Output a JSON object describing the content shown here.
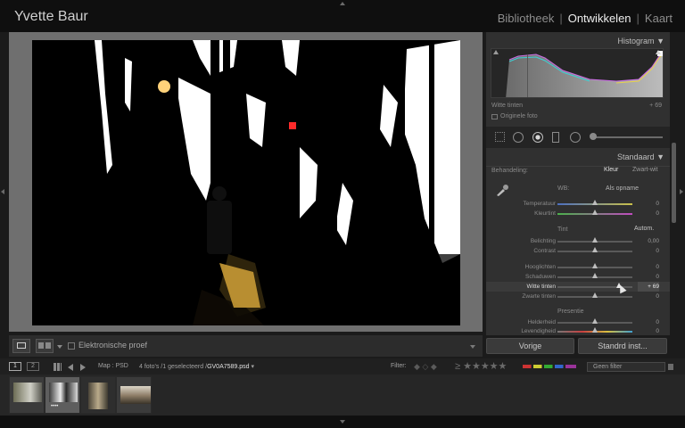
{
  "app": {
    "identity_plate": "Yvette Baur",
    "modules": [
      "Bibliotheek",
      "Ontwikkelen",
      "Kaart"
    ],
    "active_module": "Ontwikkelen"
  },
  "toolbar": {
    "proof_label": "Elektronische proef"
  },
  "histogram": {
    "title": "Histogram",
    "readout_label": "Witte tinten",
    "readout_value": "+ 69",
    "original_photo_label": "Originele foto"
  },
  "basic": {
    "title": "Standaard",
    "treatment_label": "Behandeling:",
    "treatment_color": "Kleur",
    "treatment_bw": "Zwart-wit",
    "wb_label": "WB:",
    "wb_value": "Als opname",
    "temperature": {
      "label": "Temperatuur",
      "value": "0"
    },
    "tint": {
      "label": "Kleurtint",
      "value": "0"
    },
    "tone_label": "Tint",
    "auto_label": "Autom.",
    "exposure": {
      "label": "Belichting",
      "value": "0,00"
    },
    "contrast": {
      "label": "Contrast",
      "value": "0"
    },
    "highlights": {
      "label": "Hooglichten",
      "value": "0"
    },
    "shadows": {
      "label": "Schaduwen",
      "value": "0"
    },
    "whites": {
      "label": "Witte tinten",
      "value": "+ 69"
    },
    "blacks": {
      "label": "Zwarte tinten",
      "value": "0"
    },
    "presence_label": "Presentie",
    "clarity": {
      "label": "Helderheid",
      "value": "0"
    },
    "vibrance": {
      "label": "Levendigheid",
      "value": "0"
    }
  },
  "buttons": {
    "previous": "Vorige",
    "reset": "Standrd inst..."
  },
  "filmbar": {
    "view1": "1",
    "view2": "2",
    "source": "Map : PSD",
    "count": "4 foto's /1 geselecteerd /",
    "filename": "GV0A7589.psd",
    "filter_label": "Filter:",
    "no_filter": "Geen filter"
  },
  "colors": {
    "accent": "#9bd0ff",
    "panel": "#303030"
  }
}
